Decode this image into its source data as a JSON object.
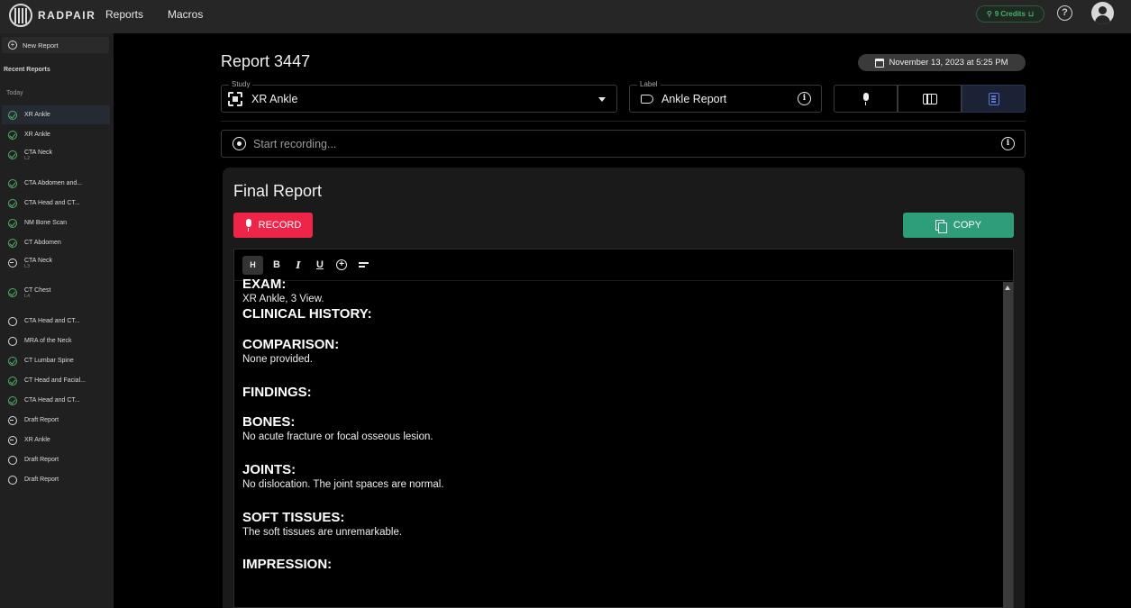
{
  "app": {
    "brand": "RADPAIR"
  },
  "topnav": {
    "items": [
      "Reports",
      "Macros"
    ]
  },
  "credits": {
    "label": "9 Credits",
    "color": "#4caf6a"
  },
  "sidebar": {
    "new_report": "New Report",
    "heading": "Recent Reports",
    "group": "Today",
    "items": [
      {
        "label": "XR Ankle",
        "sub": "",
        "status": "done",
        "active": true
      },
      {
        "label": "XR Ankle",
        "sub": "",
        "status": "done"
      },
      {
        "label": "CTA Neck",
        "sub": "L2",
        "status": "done"
      },
      {
        "label": "CTA Abdomen and...",
        "sub": "",
        "status": "done"
      },
      {
        "label": "CTA Head and CT...",
        "sub": "",
        "status": "done"
      },
      {
        "label": "NM Bone Scan",
        "sub": "",
        "status": "done"
      },
      {
        "label": "CT Abdomen",
        "sub": "",
        "status": "done"
      },
      {
        "label": "CTA Neck",
        "sub": "L3",
        "status": "minus"
      },
      {
        "label": "CT Chest",
        "sub": "L4",
        "status": "done"
      },
      {
        "label": "CTA Head and CT...",
        "sub": "",
        "status": "empty"
      },
      {
        "label": "MRA of the Neck",
        "sub": "",
        "status": "empty"
      },
      {
        "label": "CT Lumbar Spine",
        "sub": "",
        "status": "done"
      },
      {
        "label": "CT Head and Facial...",
        "sub": "",
        "status": "done"
      },
      {
        "label": "CTA Head and CT...",
        "sub": "",
        "status": "done"
      },
      {
        "label": "Draft Report",
        "sub": "",
        "status": "minus"
      },
      {
        "label": "XR Ankle",
        "sub": "",
        "status": "minus"
      },
      {
        "label": "Draft Report",
        "sub": "",
        "status": "empty"
      },
      {
        "label": "Draft Report",
        "sub": "",
        "status": "empty"
      }
    ]
  },
  "report": {
    "title_prefix": "Report",
    "number": "3447",
    "date": "November 13, 2023 at 5:25 PM",
    "study_legend": "Study",
    "study_value": "XR Ankle",
    "label_legend": "Label",
    "label_value": "Ankle Report",
    "recording_placeholder": "Start recording...",
    "panel_title": "Final Report",
    "record_label": "RECORD",
    "copy_label": "COPY",
    "record_color": "#ee2449",
    "copy_color": "#2e9e7a"
  },
  "toolbar": {
    "heading": "H",
    "bold": "B",
    "italic": "I",
    "underline": "U"
  },
  "sections": [
    {
      "heading": "EXAM:",
      "text": "XR Ankle, 3 View."
    },
    {
      "heading": "CLINICAL HISTORY:",
      "text": ""
    },
    {
      "heading": "COMPARISON:",
      "text": "None provided."
    },
    {
      "heading": "FINDINGS:",
      "text": ""
    },
    {
      "heading": "BONES:",
      "text": "No acute fracture or focal osseous lesion."
    },
    {
      "heading": "JOINTS:",
      "text": "No dislocation.  The joint spaces are normal."
    },
    {
      "heading": "SOFT TISSUES:",
      "text": "The soft tissues are unremarkable."
    },
    {
      "heading": "IMPRESSION:",
      "text": ""
    }
  ]
}
